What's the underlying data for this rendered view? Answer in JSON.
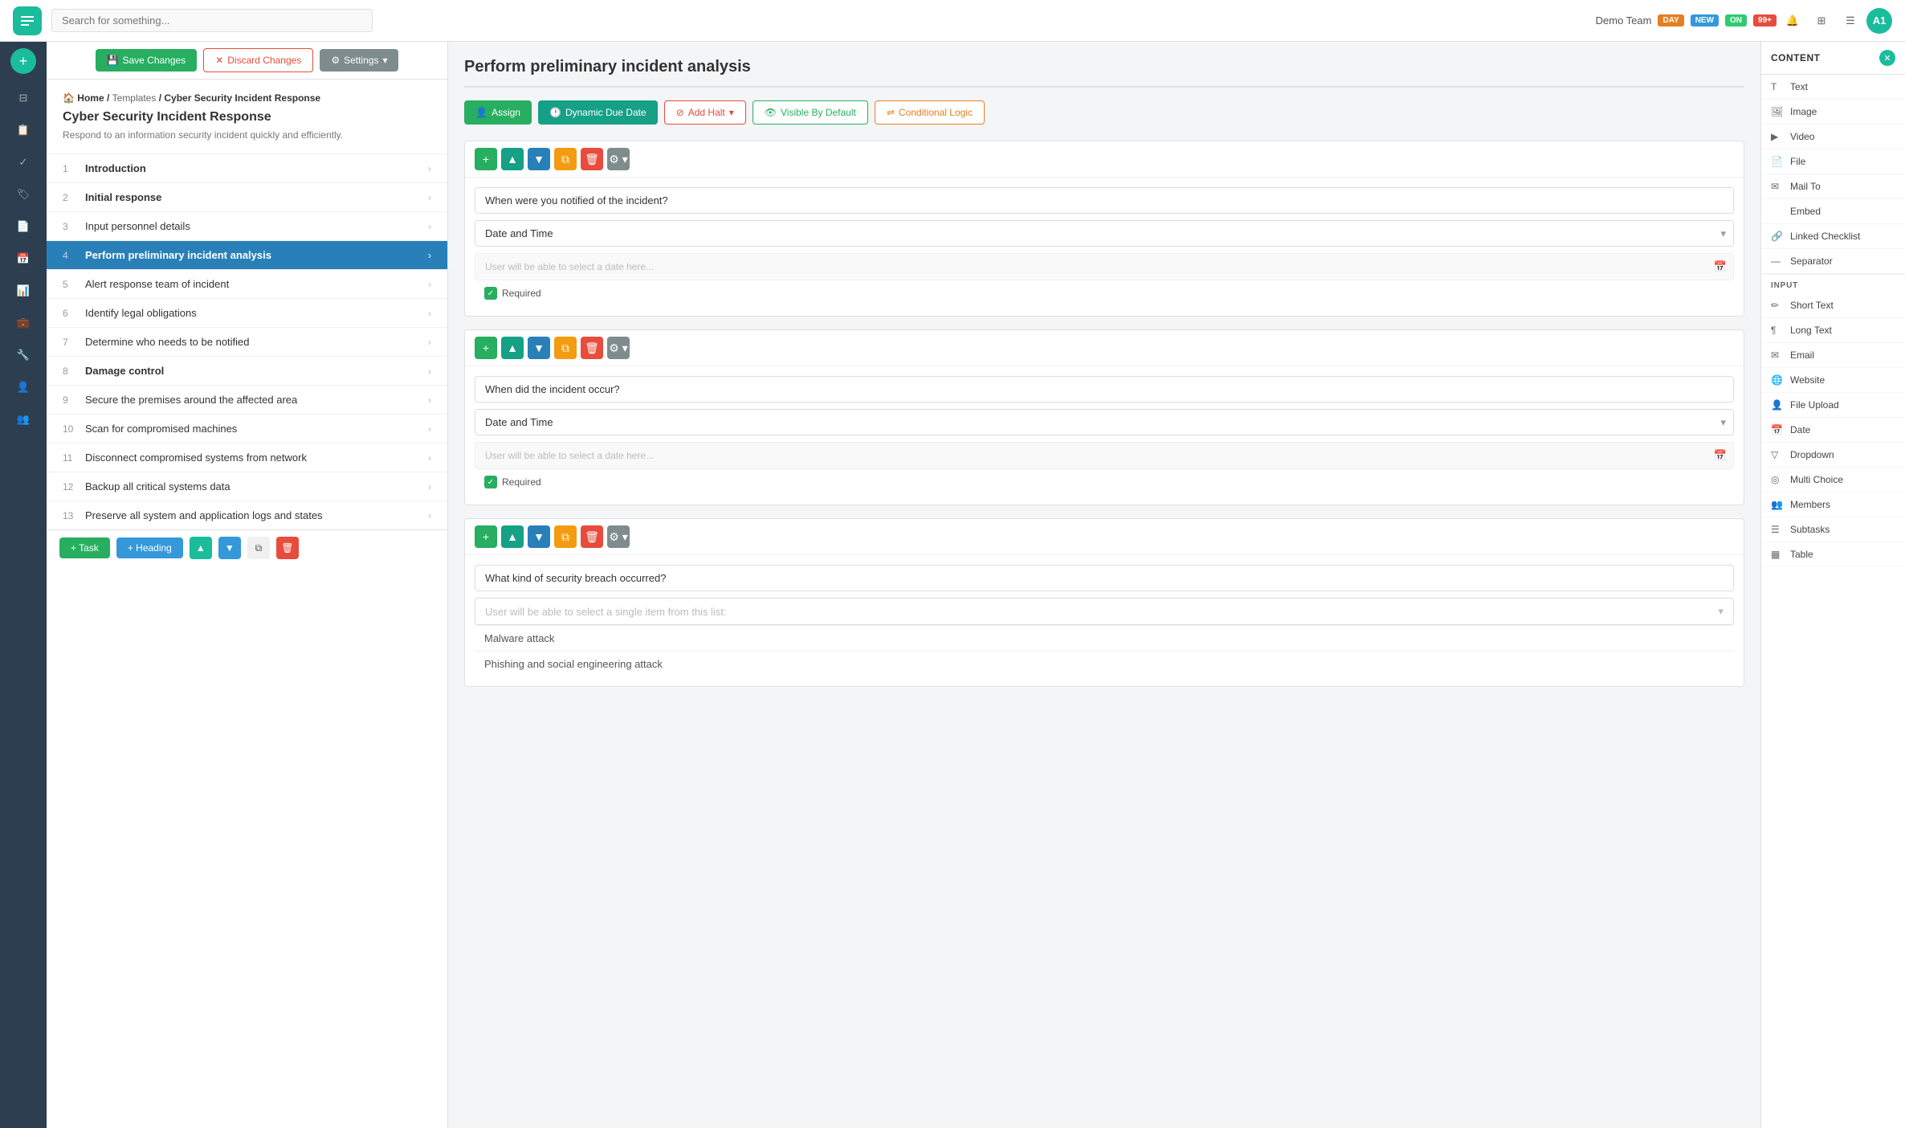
{
  "topnav": {
    "search_placeholder": "Search for something...",
    "team_name": "Demo Team",
    "badges": [
      "DAY",
      "NEW",
      "ON",
      "99+"
    ],
    "avatar": "A1"
  },
  "toolbar": {
    "save_label": "Save Changes",
    "discard_label": "Discard Changes",
    "settings_label": "Settings"
  },
  "breadcrumb": {
    "home": "Home",
    "templates": "Templates",
    "current": "Cyber Security Incident Response"
  },
  "checklist": {
    "title": "Cyber Security Incident Response",
    "description": "Respond to an information security incident quickly and efficiently.",
    "items": [
      {
        "num": "1",
        "label": "Introduction",
        "bold": true
      },
      {
        "num": "2",
        "label": "Initial response",
        "bold": true
      },
      {
        "num": "3",
        "label": "Input personnel details",
        "bold": false
      },
      {
        "num": "4",
        "label": "Perform preliminary incident analysis",
        "bold": false,
        "active": true
      },
      {
        "num": "5",
        "label": "Alert response team of incident",
        "bold": false
      },
      {
        "num": "6",
        "label": "Identify legal obligations",
        "bold": false
      },
      {
        "num": "7",
        "label": "Determine who needs to be notified",
        "bold": false
      },
      {
        "num": "8",
        "label": "Damage control",
        "bold": true
      },
      {
        "num": "9",
        "label": "Secure the premises around the affected area",
        "bold": false
      },
      {
        "num": "10",
        "label": "Scan for compromised machines",
        "bold": false
      },
      {
        "num": "11",
        "label": "Disconnect compromised systems from network",
        "bold": false
      },
      {
        "num": "12",
        "label": "Backup all critical systems data",
        "bold": false
      },
      {
        "num": "13",
        "label": "Preserve all system and application logs and states",
        "bold": false
      }
    ]
  },
  "action_buttons": {
    "assign": "Assign",
    "dynamic_due_date": "Dynamic Due Date",
    "add_halt": "Add Halt",
    "visible_by_default": "Visible By Default",
    "conditional_logic": "Conditional Logic"
  },
  "section_title": "Perform preliminary incident analysis",
  "fields": [
    {
      "id": 1,
      "question": "When were you notified of the incident?",
      "type": "Date and Time",
      "placeholder": "User will be able to select a date here...",
      "required": true
    },
    {
      "id": 2,
      "question": "When did the incident occur?",
      "type": "Date and Time",
      "placeholder": "User will be able to select a date here...",
      "required": true
    },
    {
      "id": 3,
      "question": "What kind of security breach occurred?",
      "type": "dropdown",
      "dropdown_placeholder": "User will be able to select a single item from this list:",
      "list_items": [
        "Malware attack",
        "Phishing and social engineering attack"
      ]
    }
  ],
  "right_sidebar": {
    "title": "CONTENT",
    "content_items": [
      {
        "icon": "T",
        "label": "Text"
      },
      {
        "icon": "🖼",
        "label": "Image"
      },
      {
        "icon": "▶",
        "label": "Video"
      },
      {
        "icon": "📄",
        "label": "File"
      },
      {
        "icon": "✉",
        "label": "Mail To"
      },
      {
        "icon": "</>",
        "label": "Embed"
      },
      {
        "icon": "🔗",
        "label": "Linked Checklist"
      },
      {
        "icon": "—",
        "label": "Separator"
      }
    ],
    "input_label": "INPUT",
    "input_items": [
      {
        "icon": "✏",
        "label": "Short Text"
      },
      {
        "icon": "¶",
        "label": "Long Text"
      },
      {
        "icon": "✉",
        "label": "Email"
      },
      {
        "icon": "🌐",
        "label": "Website"
      },
      {
        "icon": "👤",
        "label": "File Upload"
      },
      {
        "icon": "📅",
        "label": "Date"
      },
      {
        "icon": "▽",
        "label": "Dropdown"
      },
      {
        "icon": "◎",
        "label": "Multi Choice"
      },
      {
        "icon": "👥",
        "label": "Members"
      },
      {
        "icon": "☰",
        "label": "Subtasks"
      },
      {
        "icon": "▦",
        "label": "Table"
      }
    ]
  },
  "bottom_bar": {
    "task_label": "+ Task",
    "heading_label": "+ Heading"
  }
}
